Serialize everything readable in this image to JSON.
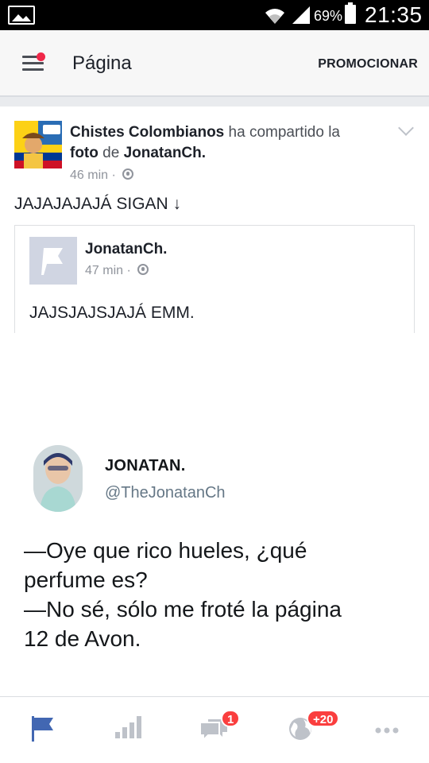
{
  "status_bar": {
    "battery_percent": "69%",
    "time": "21:35"
  },
  "app_bar": {
    "title": "Página",
    "promote_label": "PROMOCIONAR"
  },
  "post": {
    "author": "Chistes Colombianos",
    "action_text": "ha compartido la",
    "object_text": "foto",
    "preposition": "de",
    "shared_from": "JonatanCh.",
    "timestamp": "46 min",
    "text": "JAJAJAJAJÁ SIGAN ↓",
    "shared": {
      "author": "JonatanCh.",
      "timestamp": "47 min",
      "text": "JAJSJAJSJAJÁ EMM."
    }
  },
  "tweet": {
    "name": "JONATAN.",
    "handle": "@TheJonatanCh",
    "lines": [
      "—Oye que rico hueles, ¿qué",
      "perfume es?",
      "—No sé, sólo me froté la página",
      "12 de Avon."
    ]
  },
  "bottom_nav": {
    "messages_badge": "1",
    "notifications_badge": "+20"
  },
  "colors": {
    "accent": "#4267b2",
    "badge": "#fa3e3e",
    "inactive_icon": "#bec2c9"
  }
}
